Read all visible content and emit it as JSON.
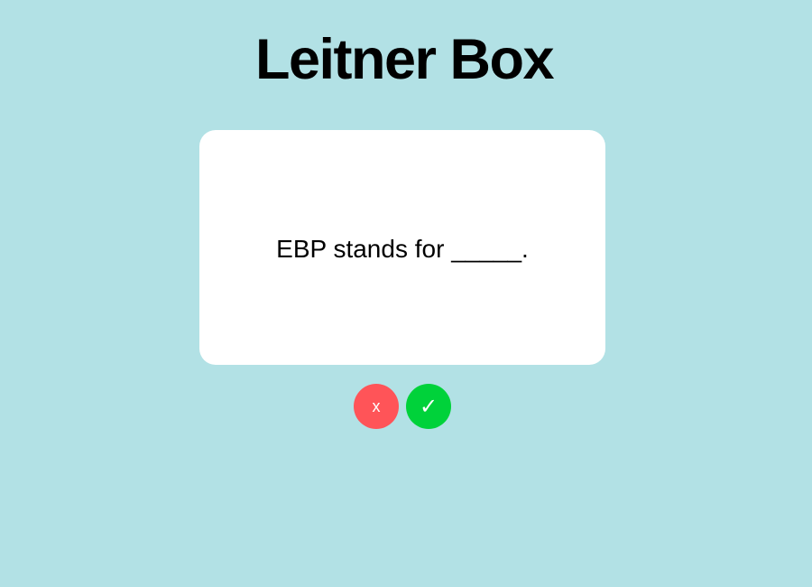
{
  "app": {
    "title": "Leitner Box"
  },
  "card": {
    "question": "EBP stands for _____."
  },
  "controls": {
    "wrong_label": "x",
    "right_label": "✓"
  },
  "colors": {
    "background": "#b2e1e5",
    "card": "#ffffff",
    "wrong_button": "#ff5458",
    "right_button": "#00d23a"
  }
}
